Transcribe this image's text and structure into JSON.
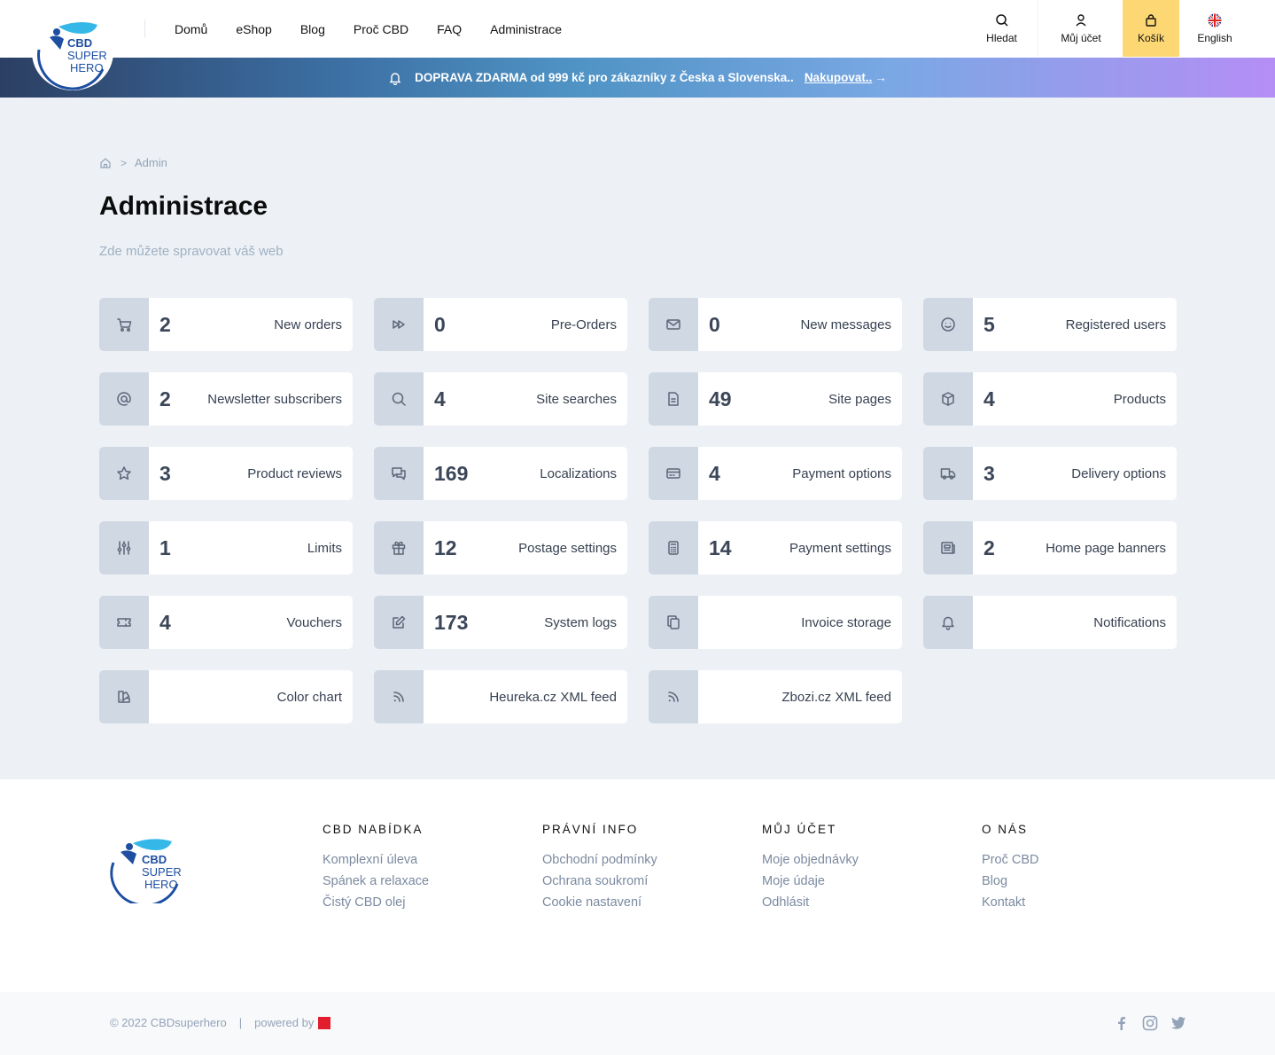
{
  "brand": {
    "logo_line1": "CBD",
    "logo_line2": "SUPER",
    "logo_line3": "HERO"
  },
  "nav": [
    "Domů",
    "eShop",
    "Blog",
    "Proč CBD",
    "FAQ",
    "Administrace"
  ],
  "header_buttons": {
    "search": "Hledat",
    "account": "Můj účet",
    "cart": "Košík",
    "lang": "English"
  },
  "promo": {
    "text": "DOPRAVA ZDARMA od 999 kč pro zákazníky z Česka a Slovenska..",
    "link": "Nakupovat..",
    "arrow": "→"
  },
  "breadcrumb": {
    "separator": ">",
    "current": "Admin"
  },
  "page": {
    "title": "Administrace",
    "subtitle": "Zde můžete spravovat váš web"
  },
  "cards": [
    {
      "icon": "cart-icon",
      "count": "2",
      "label": "New orders"
    },
    {
      "icon": "fast-forward-icon",
      "count": "0",
      "label": "Pre-Orders"
    },
    {
      "icon": "mail-icon",
      "count": "0",
      "label": "New messages"
    },
    {
      "icon": "smiley-icon",
      "count": "5",
      "label": "Registered users"
    },
    {
      "icon": "at-icon",
      "count": "2",
      "label": "Newsletter subscribers"
    },
    {
      "icon": "search-icon",
      "count": "4",
      "label": "Site searches"
    },
    {
      "icon": "document-icon",
      "count": "49",
      "label": "Site pages"
    },
    {
      "icon": "box-icon",
      "count": "4",
      "label": "Products"
    },
    {
      "icon": "star-icon",
      "count": "3",
      "label": "Product reviews"
    },
    {
      "icon": "chat-icon",
      "count": "169",
      "label": "Localizations"
    },
    {
      "icon": "credit-card-icon",
      "count": "4",
      "label": "Payment options"
    },
    {
      "icon": "truck-icon",
      "count": "3",
      "label": "Delivery options"
    },
    {
      "icon": "sliders-icon",
      "count": "1",
      "label": "Limits"
    },
    {
      "icon": "gift-icon",
      "count": "12",
      "label": "Postage settings"
    },
    {
      "icon": "calculator-icon",
      "count": "14",
      "label": "Payment settings"
    },
    {
      "icon": "newspaper-icon",
      "count": "2",
      "label": "Home page banners"
    },
    {
      "icon": "ticket-icon",
      "count": "4",
      "label": "Vouchers"
    },
    {
      "icon": "edit-icon",
      "count": "173",
      "label": "System logs"
    },
    {
      "icon": "copy-icon",
      "count": "",
      "label": "Invoice storage"
    },
    {
      "icon": "bell-icon",
      "count": "",
      "label": "Notifications"
    },
    {
      "icon": "palette-icon",
      "count": "",
      "label": "Color chart"
    },
    {
      "icon": "rss-icon",
      "count": "",
      "label": "Heureka.cz XML feed"
    },
    {
      "icon": "rss-icon",
      "count": "",
      "label": "Zbozi.cz XML feed"
    }
  ],
  "footer": {
    "columns": [
      {
        "title": "CBD NABÍDKA",
        "links": [
          "Komplexní úleva",
          "Spánek a relaxace",
          "Čistý CBD olej"
        ]
      },
      {
        "title": "PRÁVNÍ INFO",
        "links": [
          "Obchodní podmínky",
          "Ochrana soukromí",
          "Cookie nastavení"
        ]
      },
      {
        "title": "MŮJ ÚČET",
        "links": [
          "Moje objednávky",
          "Moje údaje",
          "Odhlásit"
        ]
      },
      {
        "title": "O NÁS",
        "links": [
          "Proč CBD",
          "Blog",
          "Kontakt"
        ]
      }
    ],
    "copyright": "© 2022 CBDsuperhero",
    "separator": "|",
    "powered_by": "powered by",
    "social": [
      "facebook-icon",
      "instagram-icon",
      "twitter-icon"
    ]
  },
  "colors": {
    "accent_cart": "#fcd774",
    "icon_box": "#cfd8e3",
    "page_bg": "#edf1f5"
  }
}
